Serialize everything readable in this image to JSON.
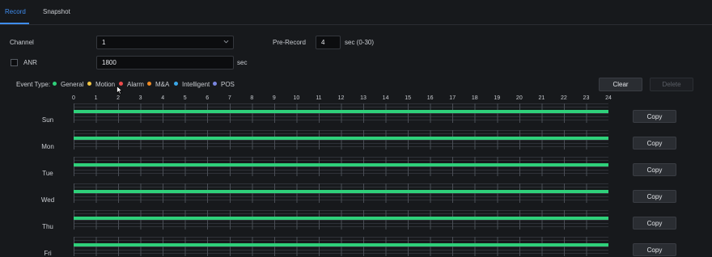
{
  "tabs": [
    {
      "label": "Record",
      "active": true
    },
    {
      "label": "Snapshot",
      "active": false
    }
  ],
  "form": {
    "channel_label": "Channel",
    "channel_value": "1",
    "prerecord_label": "Pre-Record",
    "prerecord_value": "4",
    "prerecord_unit": "sec (0-30)",
    "anr_label": "ANR",
    "anr_checked": false,
    "anr_value": "1800",
    "anr_unit": "sec"
  },
  "legend": {
    "title": "Event Type:",
    "items": [
      {
        "label": "General",
        "color": "#2fd07a"
      },
      {
        "label": "Motion",
        "color": "#f2c744"
      },
      {
        "label": "Alarm",
        "color": "#ee4b4b"
      },
      {
        "label": "M&A",
        "color": "#f08a24"
      },
      {
        "label": "Intelligent",
        "color": "#3aa7e8"
      },
      {
        "label": "POS",
        "color": "#7a86e0"
      }
    ]
  },
  "buttons": {
    "clear": "Clear",
    "delete": "Delete",
    "copy": "Copy"
  },
  "hours": [
    "0",
    "1",
    "2",
    "3",
    "4",
    "5",
    "6",
    "7",
    "8",
    "9",
    "10",
    "11",
    "12",
    "13",
    "14",
    "15",
    "16",
    "17",
    "18",
    "19",
    "20",
    "21",
    "22",
    "23",
    "24"
  ],
  "schedule": [
    {
      "day": "Sun",
      "type": "General",
      "start": 0,
      "end": 24
    },
    {
      "day": "Mon",
      "type": "General",
      "start": 0,
      "end": 24
    },
    {
      "day": "Tue",
      "type": "General",
      "start": 0,
      "end": 24
    },
    {
      "day": "Wed",
      "type": "General",
      "start": 0,
      "end": 24
    },
    {
      "day": "Thu",
      "type": "General",
      "start": 0,
      "end": 24
    },
    {
      "day": "Fri",
      "type": "General",
      "start": 0,
      "end": 24
    }
  ]
}
